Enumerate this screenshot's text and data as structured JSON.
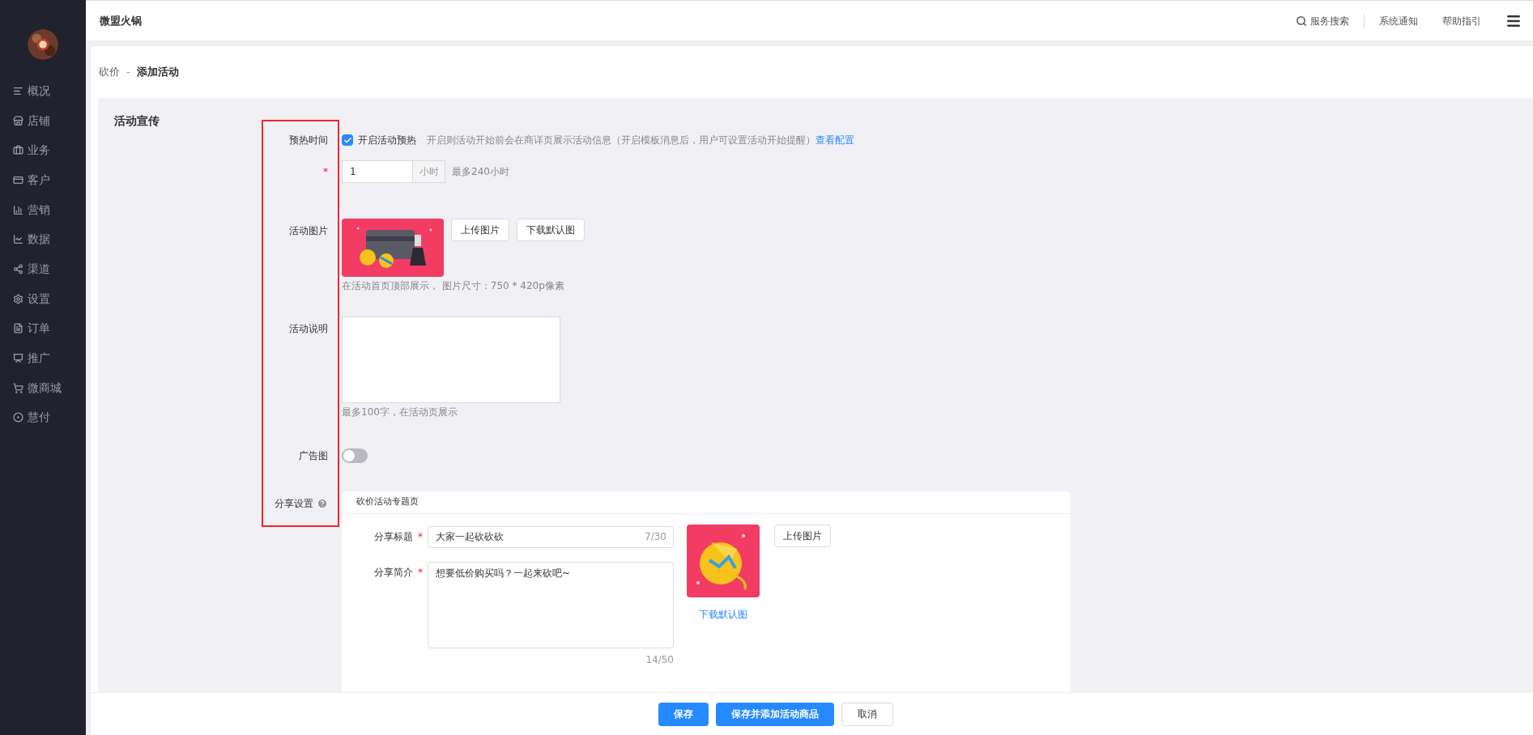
{
  "sidebar": {
    "items": [
      {
        "label": "概况"
      },
      {
        "label": "店铺"
      },
      {
        "label": "业务"
      },
      {
        "label": "客户"
      },
      {
        "label": "营销"
      },
      {
        "label": "数据"
      },
      {
        "label": "渠道"
      },
      {
        "label": "设置"
      },
      {
        "label": "订单"
      },
      {
        "label": "推广"
      },
      {
        "label": "微商城"
      },
      {
        "label": "慧付"
      }
    ]
  },
  "header": {
    "title": "微盟火锅",
    "search": "服务搜索",
    "links": [
      "系统通知",
      "帮助指引"
    ]
  },
  "breadcrumb": {
    "parent": "砍价",
    "separator": "-",
    "current": "添加活动"
  },
  "section_title": "活动宣传",
  "preheat": {
    "label": "预热时间",
    "checkbox": {
      "label": "开启活动预热",
      "checked": true
    },
    "hint": "开启则活动开始前会在商详页展示活动信息（开启模板消息后，用户可设置活动开始提醒）",
    "link": "查看配置"
  },
  "hours": {
    "required_mark": "*",
    "value": "1",
    "unit": "小时",
    "hint": "最多240小时"
  },
  "image": {
    "label": "活动图片",
    "buttons": [
      "上传图片",
      "下载默认图"
    ],
    "hint": "在活动首页顶部展示， 图片尺寸：750 * 420p像素"
  },
  "description": {
    "label": "活动说明",
    "hint": "最多100字，在活动页展示"
  },
  "ad_image": {
    "label": "广告图",
    "on": false
  },
  "share": {
    "label": "分享设置",
    "tab": "砍价活动专题页",
    "title": {
      "label": "分享标题",
      "required_mark": "*",
      "value": "大家一起砍砍砍",
      "counter": "7/30"
    },
    "intro": {
      "label": "分享简介",
      "required_mark": "*",
      "value": "想要低价购买吗？一起来砍吧~",
      "counter": "14/50"
    },
    "upload_button": "上传图片",
    "download_link": "下载默认图"
  },
  "footer": {
    "buttons": [
      {
        "label": "保存",
        "kind": "primary"
      },
      {
        "label": "保存并添加活动商品",
        "kind": "primary"
      },
      {
        "label": "取消",
        "kind": "default"
      }
    ]
  }
}
